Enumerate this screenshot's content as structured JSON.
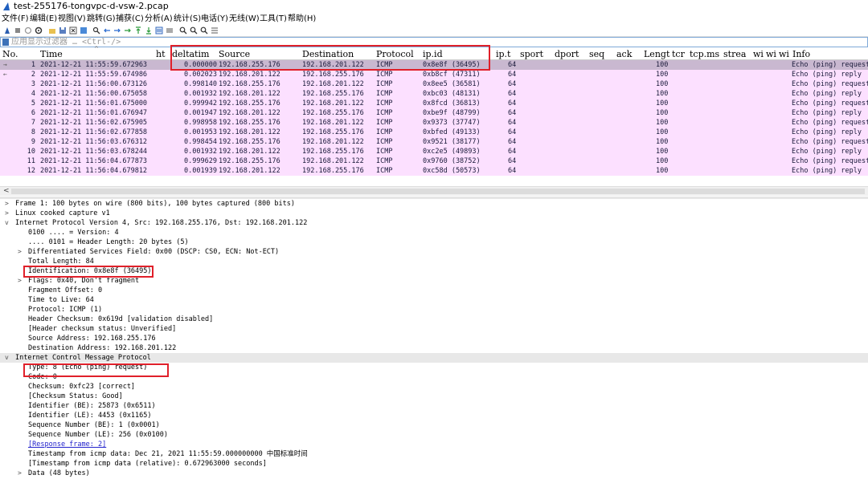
{
  "window": {
    "title": "test-255176-tongvpc-d-vsw-2.pcap"
  },
  "menu": [
    "文件(F)",
    "编辑(E)",
    "视图(V)",
    "跳转(G)",
    "捕获(C)",
    "分析(A)",
    "统计(S)",
    "电话(Y)",
    "无线(W)",
    "工具(T)",
    "帮助(H)"
  ],
  "filter": {
    "placeholder": "应用显示过滤器 … <Ctrl-/>"
  },
  "columns": {
    "no": "No.",
    "time": "Time",
    "ht": "ht",
    "deltatime": "deltatim",
    "source": "Source",
    "destination": "Destination",
    "protocol": "Protocol",
    "ipid": "ip.id",
    "ipttl": "ip.t",
    "sport": "sport",
    "dport": "dport",
    "seq": "seq",
    "ack": "ack",
    "length": "Lengt",
    "tcr": "tcr",
    "tcpms": "tcp.ms",
    "strea": "strea",
    "wi1": "wi",
    "wi2": "wi",
    "wi3": "wi",
    "info": "Info"
  },
  "packets": [
    {
      "no": "1",
      "time": "2021-12-21 11:55:59.672963",
      "delta": "0.000000",
      "src": "192.168.255.176",
      "dst": "192.168.201.122",
      "proto": "ICMP",
      "ipid": "0x8e8f (36495)",
      "ttl": "64",
      "len": "100",
      "info": "Echo (ping) request"
    },
    {
      "no": "2",
      "time": "2021-12-21 11:55:59.674986",
      "delta": "0.002023",
      "src": "192.168.201.122",
      "dst": "192.168.255.176",
      "proto": "ICMP",
      "ipid": "0xb8cf (47311)",
      "ttl": "64",
      "len": "100",
      "info": "Echo (ping) reply"
    },
    {
      "no": "3",
      "time": "2021-12-21 11:56:00.673126",
      "delta": "0.998140",
      "src": "192.168.255.176",
      "dst": "192.168.201.122",
      "proto": "ICMP",
      "ipid": "0x8ee5 (36581)",
      "ttl": "64",
      "len": "100",
      "info": "Echo (ping) request"
    },
    {
      "no": "4",
      "time": "2021-12-21 11:56:00.675058",
      "delta": "0.001932",
      "src": "192.168.201.122",
      "dst": "192.168.255.176",
      "proto": "ICMP",
      "ipid": "0xbc03 (48131)",
      "ttl": "64",
      "len": "100",
      "info": "Echo (ping) reply"
    },
    {
      "no": "5",
      "time": "2021-12-21 11:56:01.675000",
      "delta": "0.999942",
      "src": "192.168.255.176",
      "dst": "192.168.201.122",
      "proto": "ICMP",
      "ipid": "0x8fcd (36813)",
      "ttl": "64",
      "len": "100",
      "info": "Echo (ping) request"
    },
    {
      "no": "6",
      "time": "2021-12-21 11:56:01.676947",
      "delta": "0.001947",
      "src": "192.168.201.122",
      "dst": "192.168.255.176",
      "proto": "ICMP",
      "ipid": "0xbe9f (48799)",
      "ttl": "64",
      "len": "100",
      "info": "Echo (ping) reply"
    },
    {
      "no": "7",
      "time": "2021-12-21 11:56:02.675905",
      "delta": "0.998958",
      "src": "192.168.255.176",
      "dst": "192.168.201.122",
      "proto": "ICMP",
      "ipid": "0x9373 (37747)",
      "ttl": "64",
      "len": "100",
      "info": "Echo (ping) request"
    },
    {
      "no": "8",
      "time": "2021-12-21 11:56:02.677858",
      "delta": "0.001953",
      "src": "192.168.201.122",
      "dst": "192.168.255.176",
      "proto": "ICMP",
      "ipid": "0xbfed (49133)",
      "ttl": "64",
      "len": "100",
      "info": "Echo (ping) reply"
    },
    {
      "no": "9",
      "time": "2021-12-21 11:56:03.676312",
      "delta": "0.998454",
      "src": "192.168.255.176",
      "dst": "192.168.201.122",
      "proto": "ICMP",
      "ipid": "0x9521 (38177)",
      "ttl": "64",
      "len": "100",
      "info": "Echo (ping) request"
    },
    {
      "no": "10",
      "time": "2021-12-21 11:56:03.678244",
      "delta": "0.001932",
      "src": "192.168.201.122",
      "dst": "192.168.255.176",
      "proto": "ICMP",
      "ipid": "0xc2e5 (49893)",
      "ttl": "64",
      "len": "100",
      "info": "Echo (ping) reply"
    },
    {
      "no": "11",
      "time": "2021-12-21 11:56:04.677873",
      "delta": "0.999629",
      "src": "192.168.255.176",
      "dst": "192.168.201.122",
      "proto": "ICMP",
      "ipid": "0x9760 (38752)",
      "ttl": "64",
      "len": "100",
      "info": "Echo (ping) request"
    },
    {
      "no": "12",
      "time": "2021-12-21 11:56:04.679812",
      "delta": "0.001939",
      "src": "192.168.201.122",
      "dst": "192.168.255.176",
      "proto": "ICMP",
      "ipid": "0xc58d (50573)",
      "ttl": "64",
      "len": "100",
      "info": "Echo (ping) reply"
    }
  ],
  "details": [
    {
      "level": 0,
      "toggle": ">",
      "text": "Frame 1: 100 bytes on wire (800 bits), 100 bytes captured (800 bits)"
    },
    {
      "level": 0,
      "toggle": ">",
      "text": "Linux cooked capture v1"
    },
    {
      "level": 0,
      "toggle": "v",
      "text": "Internet Protocol Version 4, Src: 192.168.255.176, Dst: 192.168.201.122"
    },
    {
      "level": 1,
      "toggle": "",
      "text": "0100 .... = Version: 4"
    },
    {
      "level": 1,
      "toggle": "",
      "text": ".... 0101 = Header Length: 20 bytes (5)"
    },
    {
      "level": 1,
      "toggle": ">",
      "text": "Differentiated Services Field: 0x00 (DSCP: CS0, ECN: Not-ECT)"
    },
    {
      "level": 1,
      "toggle": "",
      "text": "Total Length: 84"
    },
    {
      "level": 1,
      "toggle": "",
      "text": "Identification: 0x8e8f (36495)"
    },
    {
      "level": 1,
      "toggle": ">",
      "text": "Flags: 0x40, Don't fragment"
    },
    {
      "level": 1,
      "toggle": "",
      "text": "Fragment Offset: 0"
    },
    {
      "level": 1,
      "toggle": "",
      "text": "Time to Live: 64"
    },
    {
      "level": 1,
      "toggle": "",
      "text": "Protocol: ICMP (1)"
    },
    {
      "level": 1,
      "toggle": "",
      "text": "Header Checksum: 0x619d [validation disabled]"
    },
    {
      "level": 1,
      "toggle": "",
      "text": "[Header checksum status: Unverified]"
    },
    {
      "level": 1,
      "toggle": "",
      "text": "Source Address: 192.168.255.176"
    },
    {
      "level": 1,
      "toggle": "",
      "text": "Destination Address: 192.168.201.122"
    },
    {
      "level": 0,
      "toggle": "v",
      "text": "Internet Control Message Protocol"
    },
    {
      "level": 1,
      "toggle": "",
      "text": "Type: 8 (Echo (ping) request)"
    },
    {
      "level": 1,
      "toggle": "",
      "text": "Code: 0"
    },
    {
      "level": 1,
      "toggle": "",
      "text": "Checksum: 0xfc23 [correct]"
    },
    {
      "level": 1,
      "toggle": "",
      "text": "[Checksum Status: Good]"
    },
    {
      "level": 1,
      "toggle": "",
      "text": "Identifier (BE): 25873 (0x6511)"
    },
    {
      "level": 1,
      "toggle": "",
      "text": "Identifier (LE): 4453 (0x1165)"
    },
    {
      "level": 1,
      "toggle": "",
      "text": "Sequence Number (BE): 1 (0x0001)"
    },
    {
      "level": 1,
      "toggle": "",
      "text": "Sequence Number (LE): 256 (0x0100)"
    },
    {
      "level": 1,
      "toggle": "",
      "text": "[Response frame: 2]",
      "link": true
    },
    {
      "level": 1,
      "toggle": "",
      "text": "Timestamp from icmp data: Dec 21, 2021 11:55:59.000000000 中国标准时间"
    },
    {
      "level": 1,
      "toggle": "",
      "text": "[Timestamp from icmp data (relative): 0.672963000 seconds]"
    },
    {
      "level": 1,
      "toggle": ">",
      "text": "Data (48 bytes)"
    }
  ],
  "colors": {
    "row_bg": "#fce0ff",
    "selected_bg": "#c9b8d0",
    "highlight": "#e0202a"
  }
}
